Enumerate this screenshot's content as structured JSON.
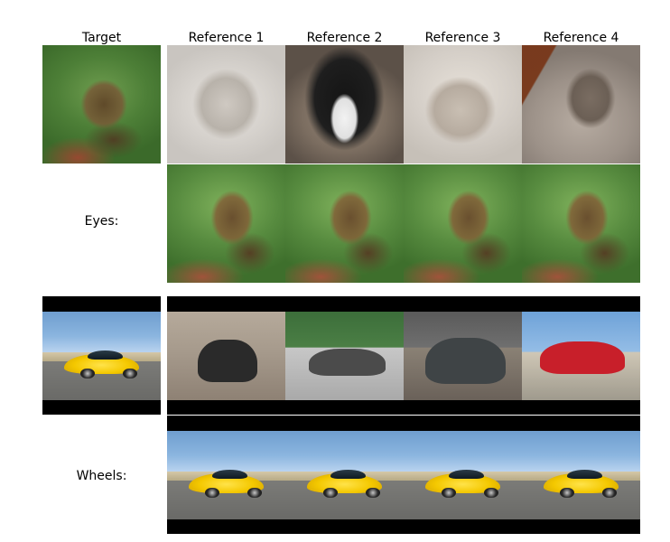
{
  "headers": {
    "target": "Target",
    "ref1": "Reference 1",
    "ref2": "Reference 2",
    "ref3": "Reference 3",
    "ref4": "Reference 4"
  },
  "rows": {
    "eyes": "Eyes:",
    "wheels": "Wheels:"
  }
}
